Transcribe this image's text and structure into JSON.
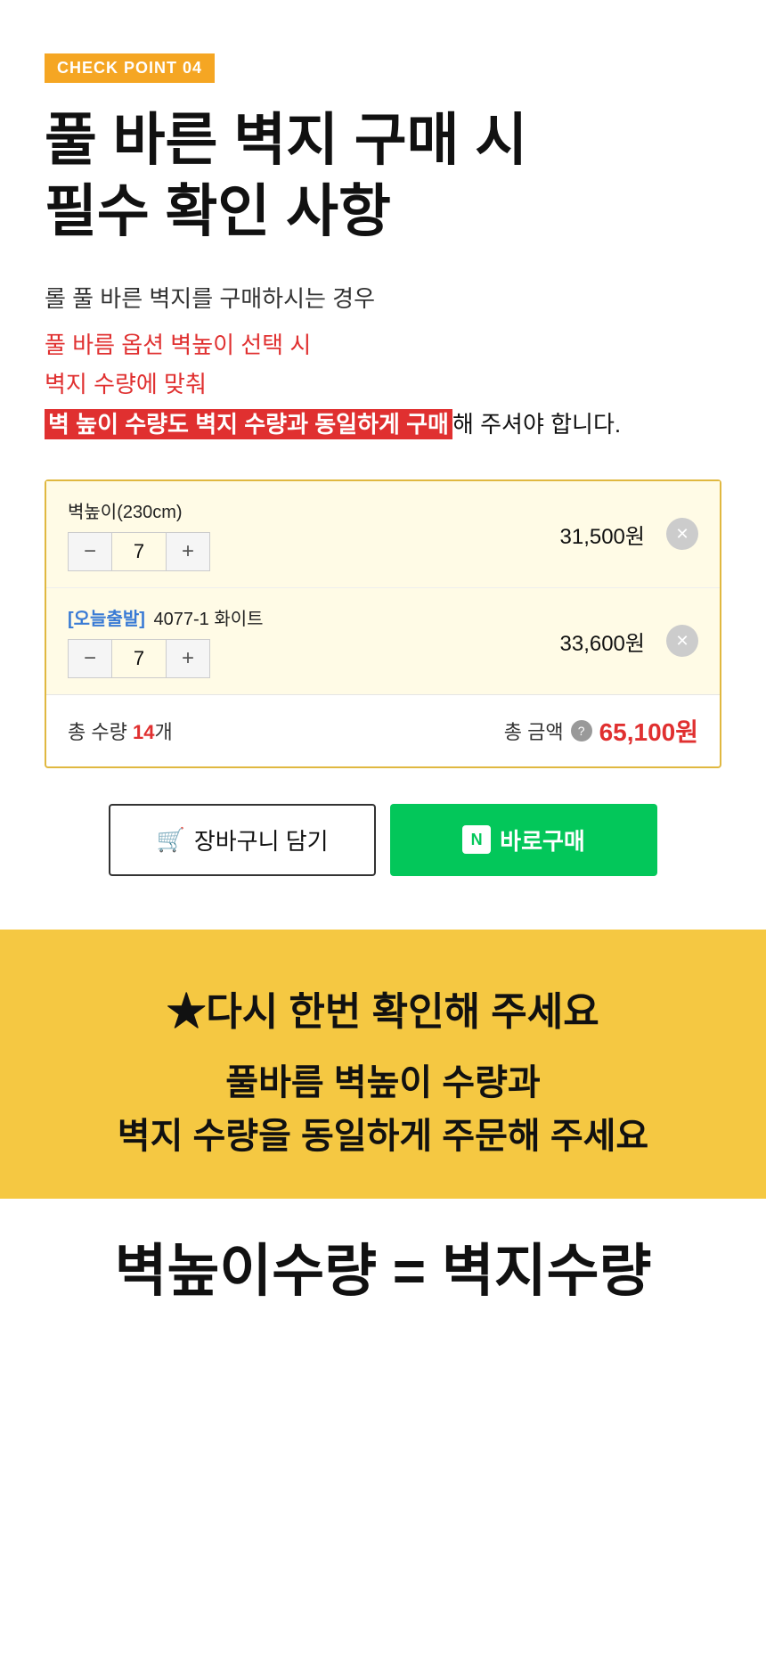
{
  "checkpoint": {
    "badge": "CHECK POINT 04",
    "title": "풀 바른 벽지 구매 시\n필수 확인 사항",
    "desc1": "롤 풀 바른 벽지를 구매하시는 경우",
    "desc2": "풀 바름 옵션 벽높이 선택 시",
    "desc3": "벽지 수량에 맞춰",
    "desc4_highlight": "벽 높이 수량도 벽지 수량과 동일하게 구매",
    "desc4_after": "해 주셔야 합니다."
  },
  "purchase": {
    "item1": {
      "label": "벽높이(230cm)",
      "qty": "7",
      "price": "31,500원"
    },
    "item2": {
      "today_badge": "[오늘출발]",
      "name": "4077-1  화이트",
      "qty": "7",
      "price": "33,600원"
    },
    "total": {
      "qty_label": "총 수량",
      "qty_value": "14",
      "qty_unit": "개",
      "price_label": "총 금액",
      "price_value": "65,100원"
    }
  },
  "buttons": {
    "cart": "장바구니 담기",
    "buy": "바로구매",
    "cart_icon": "🛒",
    "buy_n": "N"
  },
  "reminder": {
    "star_text": "★다시 한번 확인해 주세요",
    "subtitle": "풀바름 벽높이 수량과\n벽지 수량을 동일하게 주문해 주세요",
    "equation": "벽높이수량 = 벽지수량"
  }
}
